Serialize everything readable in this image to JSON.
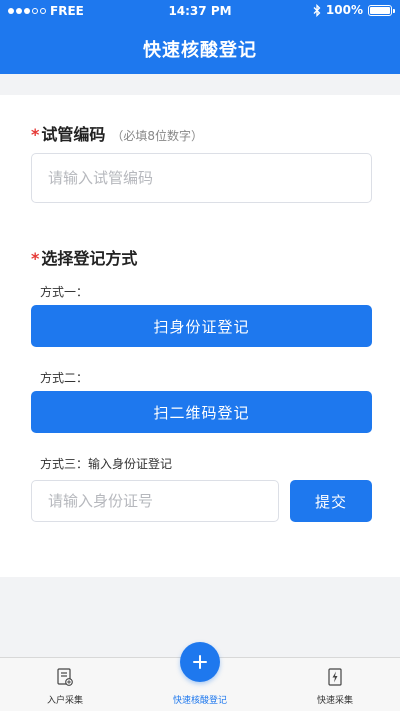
{
  "status_bar": {
    "carrier": "FREE",
    "time": "14:37 PM",
    "battery": "100%"
  },
  "header": {
    "title": "快速核酸登记"
  },
  "form": {
    "tube_label": "试管编码",
    "tube_hint": "（必填8位数字）",
    "tube_placeholder": "请输入试管编码",
    "method_label": "选择登记方式",
    "method1_label": "方式一：",
    "method1_button": "扫身份证登记",
    "method2_label": "方式二：",
    "method2_button": "扫二维码登记",
    "method3_label": "方式三：输入身份证登记",
    "id_placeholder": "请输入身份证号",
    "submit_button": "提交",
    "required_mark": "*"
  },
  "tabbar": {
    "items": [
      {
        "label": "入户采集",
        "icon": "document-add-icon",
        "active": false
      },
      {
        "label": "快速核酸登记",
        "icon": "plus-icon",
        "active": true
      },
      {
        "label": "快速采集",
        "icon": "lightning-icon",
        "active": false
      }
    ]
  },
  "colors": {
    "primary": "#1e78ee",
    "required": "#e53935",
    "background": "#f2f3f5"
  }
}
